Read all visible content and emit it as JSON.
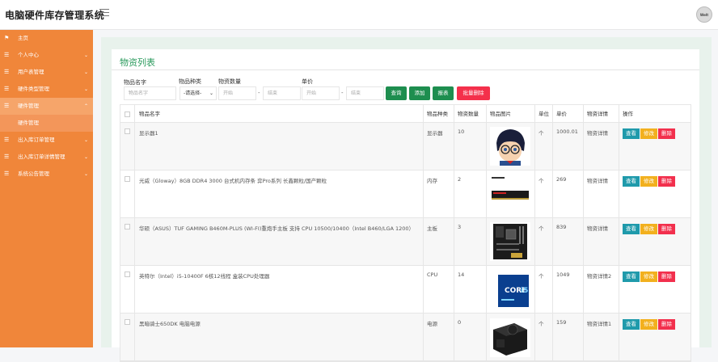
{
  "header": {
    "app_title": "电脑硬件库存管理系统",
    "avatar_text": "Welt"
  },
  "sidebar": {
    "items": [
      {
        "label": "主页"
      },
      {
        "label": "个人中心"
      },
      {
        "label": "用户表管理"
      },
      {
        "label": "硬件类型管理"
      },
      {
        "label": "硬件管理"
      },
      {
        "label": "硬件管理"
      },
      {
        "label": "出入库订单管理"
      },
      {
        "label": "出入库订单详情管理"
      },
      {
        "label": "系统公告管理"
      }
    ]
  },
  "panel": {
    "title": "物资列表"
  },
  "filters": {
    "name_label": "物品名字",
    "name_placeholder": "物品名字",
    "type_label": "物品种类",
    "type_selected": "-请选择-",
    "qty_label": "物资数量",
    "qty_start": "开始",
    "qty_end": "结束",
    "price_label": "单价",
    "price_start": "开始",
    "price_end": "结束",
    "dash": "-",
    "search_btn": "查询",
    "add_btn": "添加",
    "report_btn": "报表",
    "batch_delete_btn": "批量删除"
  },
  "table": {
    "headers": [
      "物品名字",
      "物品种类",
      "物资数量",
      "物品图片",
      "单位",
      "单价",
      "物资详情",
      "操作"
    ],
    "actions": {
      "view": "查看",
      "edit": "修改",
      "delete": "删除"
    },
    "rows": [
      {
        "name": "显示器1",
        "type": "显示器",
        "qty": "10",
        "unit": "个",
        "price": "1000.01",
        "detail": "物资详情",
        "image": "anime-character"
      },
      {
        "name": "光威（Gloway）8GB DDR4 3000 台式机内存条 弈Pro系列 长鑫颗粒/国产颗粒",
        "type": "内存",
        "qty": "2",
        "unit": "个",
        "price": "269",
        "detail": "物资详情",
        "image": "memory-stick"
      },
      {
        "name": "华硕（ASUS）TUF GAMING B460M-PLUS (WI-FI)重炮手主板 支持 CPU 10500/10400（Intel B460/LGA 1200）",
        "type": "主板",
        "qty": "3",
        "unit": "个",
        "price": "839",
        "detail": "物资详情",
        "image": "motherboard"
      },
      {
        "name": "英特尔（Intel）i5-10400F 6核12线程 盒装CPU处理器",
        "type": "CPU",
        "qty": "14",
        "unit": "个",
        "price": "1049",
        "detail": "物资详情2",
        "image": "cpu-box"
      },
      {
        "name": "黑暗骑士650DK 电脑电源",
        "type": "电源",
        "qty": "0",
        "unit": "个",
        "price": "159",
        "detail": "物资详情1",
        "image": "power-supply"
      }
    ]
  },
  "colors": {
    "sidebar": "#f0863a",
    "accent_green": "#1e8e4f",
    "danger": "#f4304b",
    "view": "#1f9aab",
    "edit": "#f2b01e"
  }
}
